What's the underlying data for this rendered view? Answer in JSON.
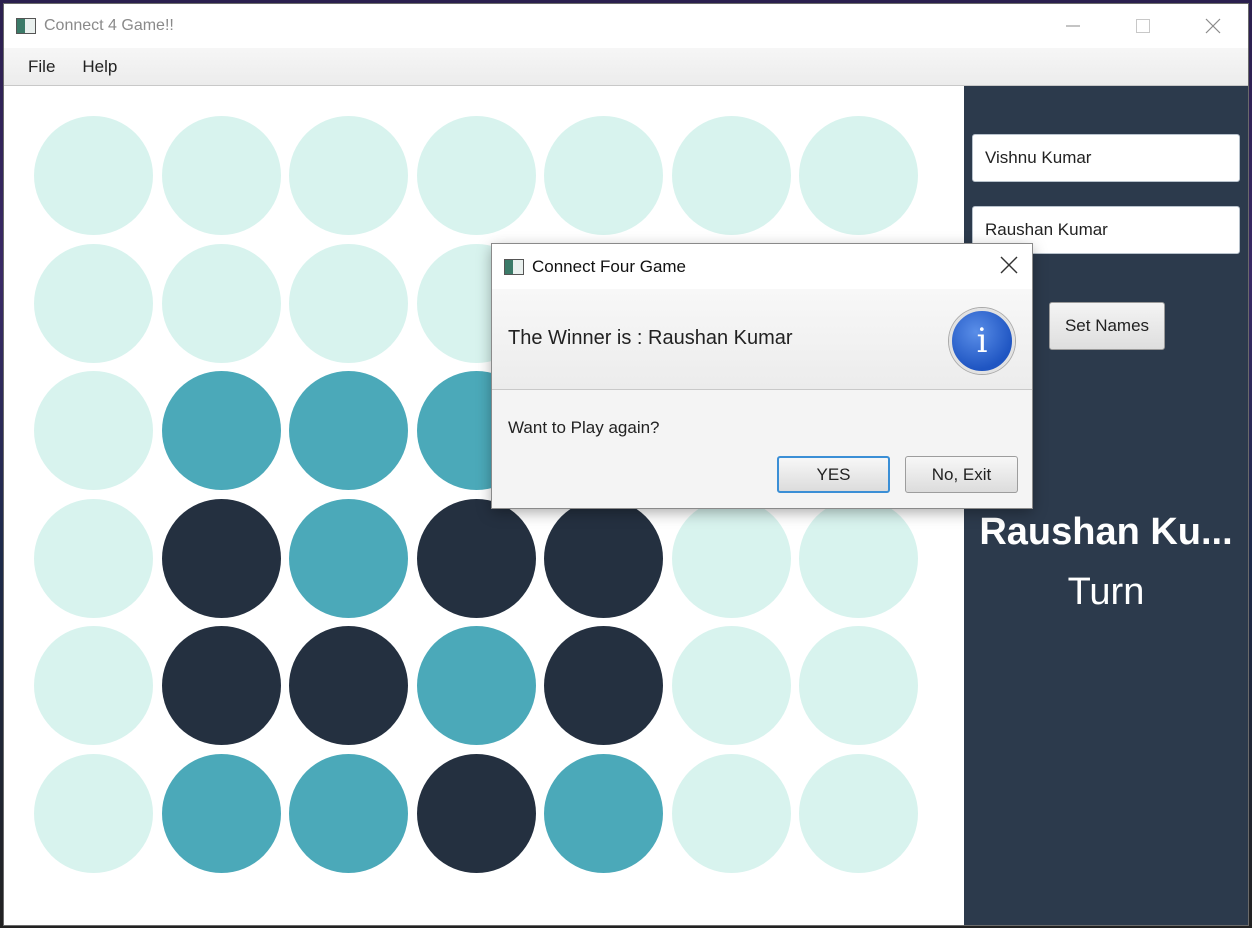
{
  "window": {
    "title": "Connect 4 Game!!"
  },
  "menu": {
    "items": [
      "File",
      "Help"
    ]
  },
  "colors": {
    "empty": "#d8f3ee",
    "player_two_disc": "#4ba9b9",
    "player_one_disc": "#243040",
    "sidebar": "#2c3a4c"
  },
  "board": {
    "rows": 6,
    "cols": 7,
    "grid": [
      [
        "empty",
        "empty",
        "empty",
        "empty",
        "empty",
        "empty",
        "empty"
      ],
      [
        "empty",
        "empty",
        "empty",
        "empty",
        "empty",
        "empty",
        "empty"
      ],
      [
        "empty",
        "teal",
        "teal",
        "teal",
        "empty",
        "empty",
        "empty"
      ],
      [
        "empty",
        "dark",
        "teal",
        "dark",
        "dark",
        "empty",
        "empty"
      ],
      [
        "empty",
        "dark",
        "dark",
        "teal",
        "dark",
        "empty",
        "empty"
      ],
      [
        "empty",
        "teal",
        "teal",
        "dark",
        "teal",
        "empty",
        "empty"
      ]
    ]
  },
  "sidebar": {
    "player_one": "Vishnu Kumar",
    "player_two": "Raushan Kumar",
    "set_names_label": "Set Names",
    "turn_name": "Raushan Ku...",
    "turn_label": "Turn"
  },
  "dialog": {
    "title": "Connect Four Game",
    "header": "The Winner is : Raushan Kumar",
    "info_icon": "i",
    "content": "Want to Play again?",
    "yes_label": "YES",
    "no_label": "No, Exit"
  }
}
